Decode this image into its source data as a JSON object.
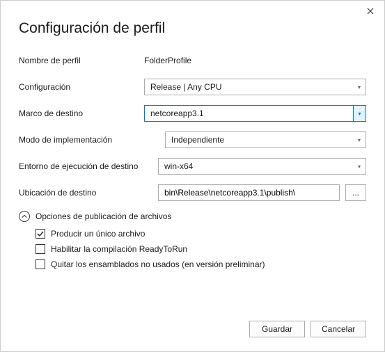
{
  "title": "Configuración de perfil",
  "labels": {
    "profile_name": "Nombre de perfil",
    "configuration": "Configuración",
    "target_framework": "Marco de destino",
    "deployment_mode": "Modo de implementación",
    "target_runtime": "Entorno de ejecución de destino",
    "target_location": "Ubicación de destino"
  },
  "values": {
    "profile_name": "FolderProfile",
    "configuration": "Release | Any CPU",
    "target_framework": "netcoreapp3.1",
    "deployment_mode": "Independiente",
    "target_runtime": "win-x64",
    "target_location": "bin\\Release\\netcoreapp3.1\\publish\\"
  },
  "browse_label": "...",
  "expander": {
    "label": "Opciones de publicación de archivos"
  },
  "checkboxes": {
    "single_file": {
      "label": "Producir un único archivo",
      "checked": true
    },
    "ready_to_run": {
      "label": "Habilitar la compilación ReadyToRun",
      "checked": false
    },
    "trim_unused": {
      "label": "Quitar los ensamblados no usados (en versión preliminar)",
      "checked": false
    }
  },
  "buttons": {
    "save": "Guardar",
    "cancel": "Cancelar"
  }
}
